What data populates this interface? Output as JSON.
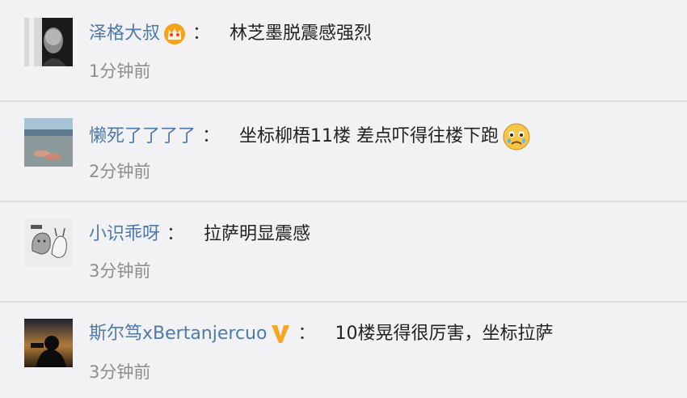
{
  "comments": [
    {
      "username": "泽格大叔",
      "separator": "：",
      "text": "林芝墨脱震感强烈",
      "time": "1分钟前",
      "badge": "crown-icon"
    },
    {
      "username": "懒死了了了了",
      "separator": "：",
      "text": "坐标柳梧11楼 差点吓得往楼下跑",
      "time": "2分钟前",
      "emoji": "crying-face-emoji"
    },
    {
      "username": "小识乖呀",
      "separator": "：",
      "text": "拉萨明显震感",
      "time": "3分钟前"
    },
    {
      "username": "斯尔笃xBertanjercuo",
      "separator": "：",
      "text": "10楼晃得很厉害，坐标拉萨",
      "time": "3分钟前",
      "badge": "verified-v-icon"
    }
  ],
  "colors": {
    "background": "#f2f2f5",
    "username": "#4e7aa9",
    "text": "#222222",
    "time": "#8d8d8d",
    "divider": "#dcdce0",
    "verified": "#f5a623"
  }
}
